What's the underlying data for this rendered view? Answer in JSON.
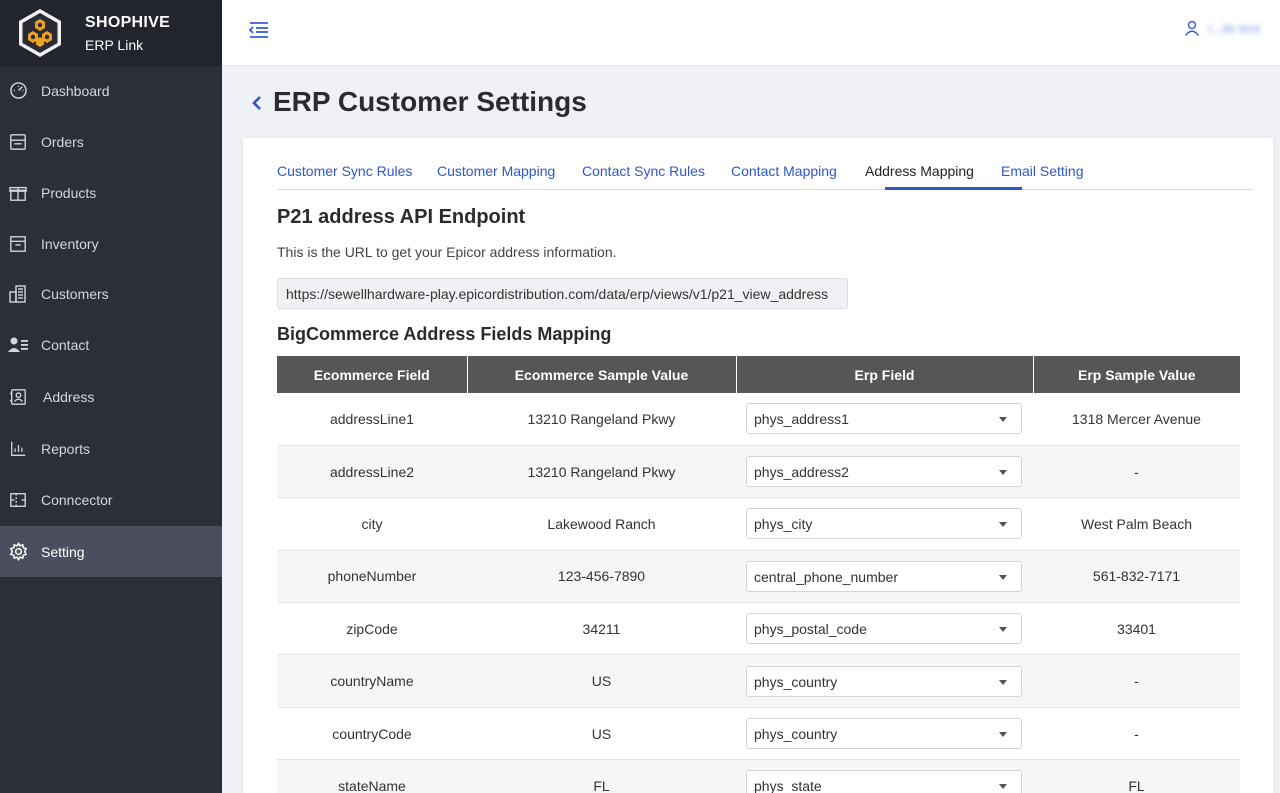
{
  "brand": {
    "name": "SHOPHIVE",
    "sub": "ERP Link"
  },
  "sidebar": {
    "items": [
      {
        "label": "Dashboard",
        "icon": "dashboard-icon"
      },
      {
        "label": "Orders",
        "icon": "orders-icon"
      },
      {
        "label": "Products",
        "icon": "products-icon"
      },
      {
        "label": "Inventory",
        "icon": "inventory-icon"
      },
      {
        "label": "Customers",
        "icon": "customers-icon"
      },
      {
        "label": "Contact",
        "icon": "contact-icon"
      },
      {
        "label": "Address",
        "icon": "address-icon"
      },
      {
        "label": "Reports",
        "icon": "reports-icon"
      },
      {
        "label": "Conncector",
        "icon": "connector-icon"
      },
      {
        "label": "Setting",
        "icon": "gear-icon",
        "active": true
      }
    ]
  },
  "header": {
    "user": "r...ile test"
  },
  "page": {
    "title": "ERP Customer Settings"
  },
  "tabs": [
    {
      "label": "Customer Sync Rules"
    },
    {
      "label": "Customer Mapping"
    },
    {
      "label": "Contact Sync Rules"
    },
    {
      "label": "Contact Mapping"
    },
    {
      "label": "Address Mapping",
      "active": true
    },
    {
      "label": "Email Setting"
    }
  ],
  "endpoint": {
    "title": "P21 address API Endpoint",
    "description": "This is the URL to get your Epicor address information.",
    "url": "https://sewellhardware-play.epicordistribution.com/data/erp/views/v1/p21_view_address"
  },
  "mapping": {
    "title": "BigCommerce Address Fields Mapping",
    "columns": [
      "Ecommerce Field",
      "Ecommerce Sample Value",
      "Erp Field",
      "Erp Sample Value"
    ],
    "rows": [
      {
        "field": "addressLine1",
        "sample": "13210 Rangeland Pkwy",
        "erp_field": "phys_address1",
        "erp_sample": "1318 Mercer Avenue"
      },
      {
        "field": "addressLine2",
        "sample": "13210 Rangeland Pkwy",
        "erp_field": "phys_address2",
        "erp_sample": "-"
      },
      {
        "field": "city",
        "sample": "Lakewood Ranch",
        "erp_field": "phys_city",
        "erp_sample": "West Palm Beach"
      },
      {
        "field": "phoneNumber",
        "sample": "123-456-7890",
        "erp_field": "central_phone_number",
        "erp_sample": "561-832-7171"
      },
      {
        "field": "zipCode",
        "sample": "34211",
        "erp_field": "phys_postal_code",
        "erp_sample": "33401"
      },
      {
        "field": "countryName",
        "sample": "US",
        "erp_field": "phys_country",
        "erp_sample": "-"
      },
      {
        "field": "countryCode",
        "sample": "US",
        "erp_field": "phys_country",
        "erp_sample": "-"
      },
      {
        "field": "stateName",
        "sample": "FL",
        "erp_field": "phys_state",
        "erp_sample": "FL"
      }
    ]
  },
  "colors": {
    "sidebar": "#2c2f3a",
    "active_nav": "#4a4e5f",
    "accent": "#2f57c9",
    "table_header": "#555658"
  }
}
